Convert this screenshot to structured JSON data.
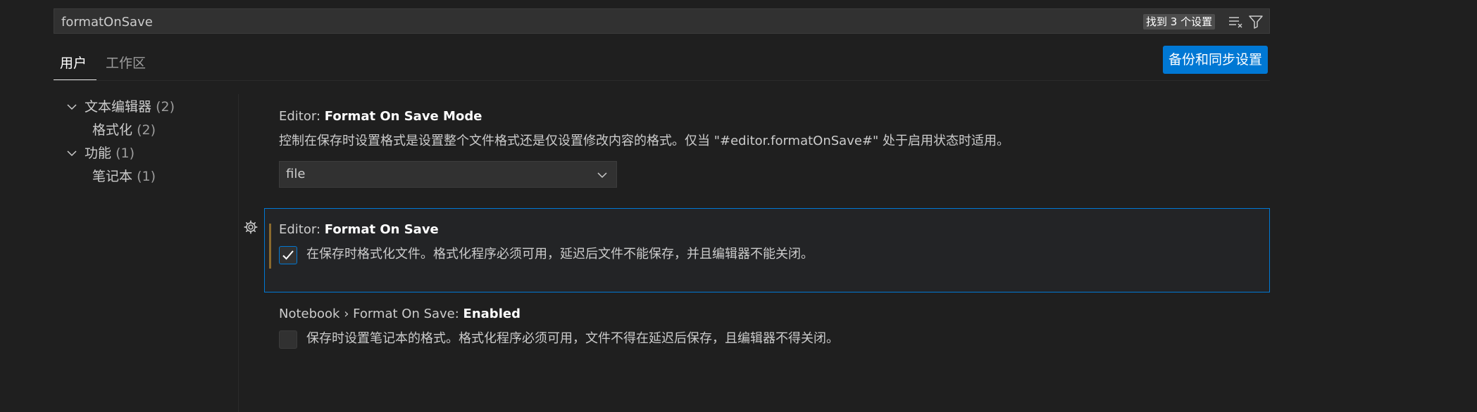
{
  "search": {
    "value": "formatOnSave",
    "result_badge": "找到 3 个设置",
    "icons": [
      "clear-filter-icon",
      "filter-icon"
    ]
  },
  "tabs": [
    {
      "label": "用户",
      "active": true
    },
    {
      "label": "工作区",
      "active": false
    }
  ],
  "backup_button": "备份和同步设置",
  "toc": [
    {
      "label": "文本编辑器",
      "count": "(2)",
      "level": 0,
      "expanded": true
    },
    {
      "label": "格式化",
      "count": "(2)",
      "level": 1
    },
    {
      "label": "功能",
      "count": "(1)",
      "level": 0,
      "expanded": true
    },
    {
      "label": "笔记本",
      "count": "(1)",
      "level": 1
    }
  ],
  "settings": [
    {
      "prefix": "Editor: ",
      "name": "Format On Save Mode",
      "description": "控制在保存时设置格式是设置整个文件格式还是仅设置修改内容的格式。仅当 \"#editor.formatOnSave#\" 处于启用状态时适用。",
      "control": "dropdown",
      "value": "file"
    },
    {
      "prefix": "Editor: ",
      "name": "Format On Save",
      "description": "在保存时格式化文件。格式化程序必须可用，延迟后文件不能保存，并且编辑器不能关闭。",
      "control": "checkbox",
      "checked": true,
      "modified": true,
      "focused": true
    },
    {
      "prefix": "Notebook › Format On Save: ",
      "name": "Enabled",
      "description": "保存时设置笔记本的格式。格式化程序必须可用，文件不得在延迟后保存，且编辑器不得关闭。",
      "control": "checkbox",
      "checked": false
    }
  ],
  "colors": {
    "accent": "#0078d4",
    "background": "#1f1f1f",
    "modified_indicator": "#8b6a2e"
  }
}
